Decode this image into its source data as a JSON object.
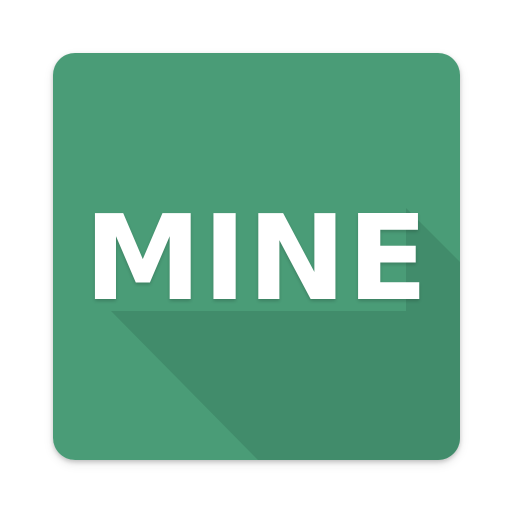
{
  "icon": {
    "label": "MINE",
    "background_color": "#4a9c77",
    "shadow_color": "#3f8a68",
    "text_color": "#ffffff"
  }
}
